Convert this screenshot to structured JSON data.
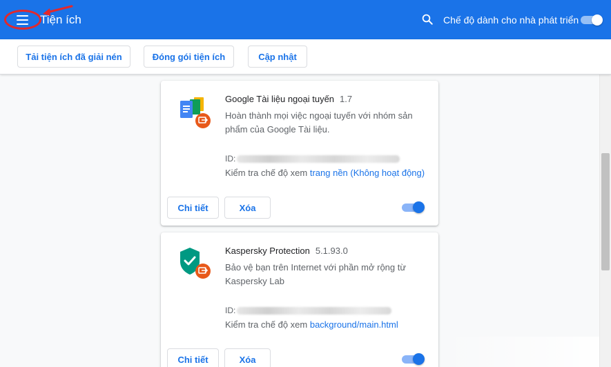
{
  "header": {
    "title": "Tiện ích",
    "search_icon": "search-icon",
    "dev_mode_label": "Chế độ dành cho nhà phát triển",
    "dev_mode_on": true,
    "brand_color": "#1a73e8"
  },
  "toolbar": {
    "load_unpacked": "Tải tiện ích đã giải nén",
    "pack_extension": "Đóng gói tiện ích",
    "update": "Cập nhật"
  },
  "extensions": [
    {
      "name": "Google Tài liệu ngoại tuyến",
      "version": "1.7",
      "description": "Hoàn thành mọi việc ngoại tuyến với nhóm sản phẩm của Google Tài liệu.",
      "id_label": "ID:",
      "inspect_label": "Kiểm tra chế độ xem",
      "inspect_link": "trang nền (Không hoạt động)",
      "details_label": "Chi tiết",
      "remove_label": "Xóa",
      "enabled": true,
      "icon": "google-docs-offline-icon"
    },
    {
      "name": "Kaspersky Protection",
      "version": "5.1.93.0",
      "description": "Bảo vệ bạn trên Internet với phần mở rộng từ Kaspersky Lab",
      "id_label": "ID:",
      "inspect_label": "Kiểm tra chế độ xem",
      "inspect_link": "background/main.html",
      "details_label": "Chi tiết",
      "remove_label": "Xóa",
      "enabled": true,
      "icon": "kaspersky-shield-icon"
    }
  ]
}
